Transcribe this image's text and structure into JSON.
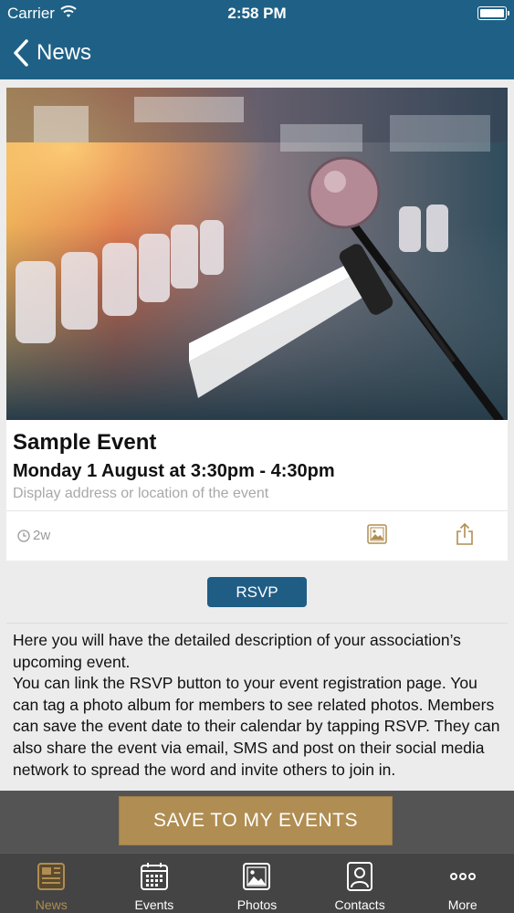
{
  "status_bar": {
    "carrier": "Carrier",
    "time": "2:58 PM"
  },
  "nav": {
    "back_label": "News"
  },
  "event": {
    "title": "Sample Event",
    "datetime": "Monday 1 August at 3:30pm - 4:30pm",
    "location": "Display address or location of the event",
    "age": "2w"
  },
  "rsvp_label": "RSVP",
  "description": [
    "Here you will have the detailed description of your association’s upcoming event.",
    "You can link the RSVP button to your event registration page. You can tag a photo album for members to see related photos. Members can save the event date to their calendar by tapping RSVP. They can  also share the event via email, SMS and post on their social media network to spread the word and invite others to join in."
  ],
  "save_label": "SAVE TO MY EVENTS",
  "tabs": [
    {
      "label": "News",
      "icon": "newspaper-icon",
      "active": true
    },
    {
      "label": "Events",
      "icon": "calendar-icon",
      "active": false
    },
    {
      "label": "Photos",
      "icon": "photo-icon",
      "active": false
    },
    {
      "label": "Contacts",
      "icon": "contact-card-icon",
      "active": false
    },
    {
      "label": "More",
      "icon": "more-dots-icon",
      "active": false
    }
  ],
  "colors": {
    "header": "#1f6186",
    "accent_gold": "#b08d52",
    "rsvp": "#1f5d85",
    "tabbar": "#444444"
  }
}
